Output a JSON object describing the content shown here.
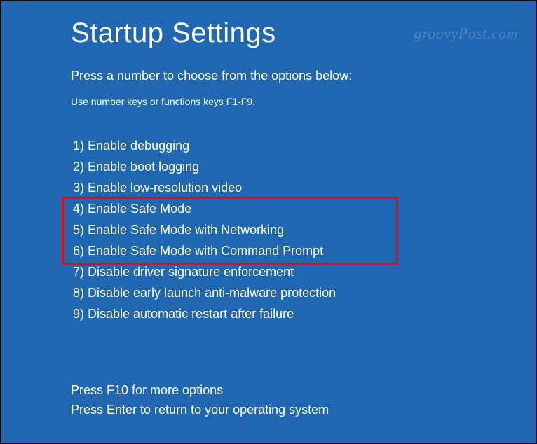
{
  "title": "Startup Settings",
  "subtitle": "Press a number to choose from the options below:",
  "hint": "Use number keys or functions keys F1-F9.",
  "options": [
    "1) Enable debugging",
    "2) Enable boot logging",
    "3) Enable low-resolution video",
    "4) Enable Safe Mode",
    "5) Enable Safe Mode with Networking",
    "6) Enable Safe Mode with Command Prompt",
    "7) Disable driver signature enforcement",
    "8) Disable early launch anti-malware protection",
    "9) Disable automatic restart after failure"
  ],
  "footer": {
    "more": "Press F10 for more options",
    "return": "Press Enter to return to your operating system"
  },
  "watermark": "groovyPost.com"
}
